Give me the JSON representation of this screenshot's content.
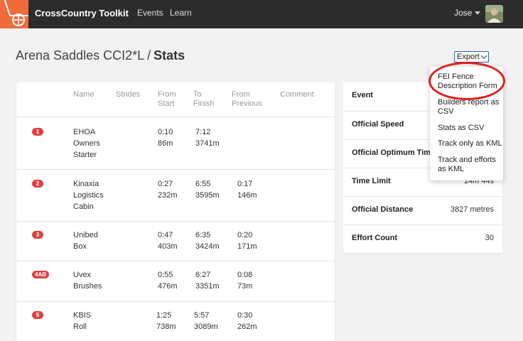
{
  "app": {
    "brand": "CrossCountry Toolkit",
    "nav": {
      "events": "Events",
      "learn": "Learn"
    },
    "user": {
      "name": "Jose"
    }
  },
  "page": {
    "event_name": "Arena Saddles CCI2*L",
    "separator": "/",
    "section": "Stats"
  },
  "export": {
    "label": "Export",
    "menu_items": [
      "FEI Fence Description Form",
      "Builders report as CSV",
      "Stats as CSV",
      "Track only as KML",
      "Track and efforts as KML"
    ]
  },
  "stats_table": {
    "headers": {
      "name": "Name",
      "strides": "Strides",
      "from_start": [
        "From",
        "Start"
      ],
      "to_finish": [
        "To",
        "Finish"
      ],
      "from_previous": [
        "From",
        "Previous"
      ],
      "comment": "Comment"
    },
    "rows": [
      {
        "badge": "1",
        "name": [
          "EHOA",
          "Owners",
          "Starter"
        ],
        "from_start": [
          "0:10",
          "86m"
        ],
        "to_finish": [
          "7:12",
          "3741m"
        ],
        "from_previous": [
          "",
          ""
        ]
      },
      {
        "badge": "2",
        "name": [
          "Kinaxia",
          "Logistics",
          "Cabin"
        ],
        "from_start": [
          "0:27",
          "232m"
        ],
        "to_finish": [
          "6:55",
          "3595m"
        ],
        "from_previous": [
          "0:17",
          "146m"
        ]
      },
      {
        "badge": "3",
        "name": [
          "Unibed",
          "Box"
        ],
        "from_start": [
          "0:47",
          "403m"
        ],
        "to_finish": [
          "6:35",
          "3424m"
        ],
        "from_previous": [
          "0:20",
          "171m"
        ]
      },
      {
        "badge": "4AB",
        "name": [
          "Uvex",
          "Brushes"
        ],
        "from_start": [
          "0:55",
          "476m"
        ],
        "to_finish": [
          "6:27",
          "3351m"
        ],
        "from_previous": [
          "0:08",
          "73m"
        ]
      },
      {
        "badge": "5",
        "name": [
          "KBIS",
          "Roll"
        ],
        "from_start": [
          "1:25",
          "738m"
        ],
        "to_finish": [
          "5:57",
          "3089m"
        ],
        "from_previous": [
          "0:30",
          "262m"
        ]
      }
    ]
  },
  "summary": {
    "rows": [
      {
        "label": "Event",
        "value": ""
      },
      {
        "label": "Official Speed",
        "value": ""
      },
      {
        "label": "Official Optimum Time",
        "value": ""
      },
      {
        "label": "Time Limit",
        "value": "14m 44s"
      },
      {
        "label": "Official Distance",
        "value": "3827 metres"
      },
      {
        "label": "Effort Count",
        "value": "30"
      }
    ]
  },
  "colors": {
    "topbar": "#2c2c2c",
    "logo": "#f26b3a",
    "badge": "#e04040",
    "annotation": "#e0201b",
    "export_border": "#2a60b8"
  },
  "icons": {
    "logo": "cart-wheel-icon",
    "user_menu": "chevron-down-icon",
    "export_menu": "chevron-down-icon"
  }
}
